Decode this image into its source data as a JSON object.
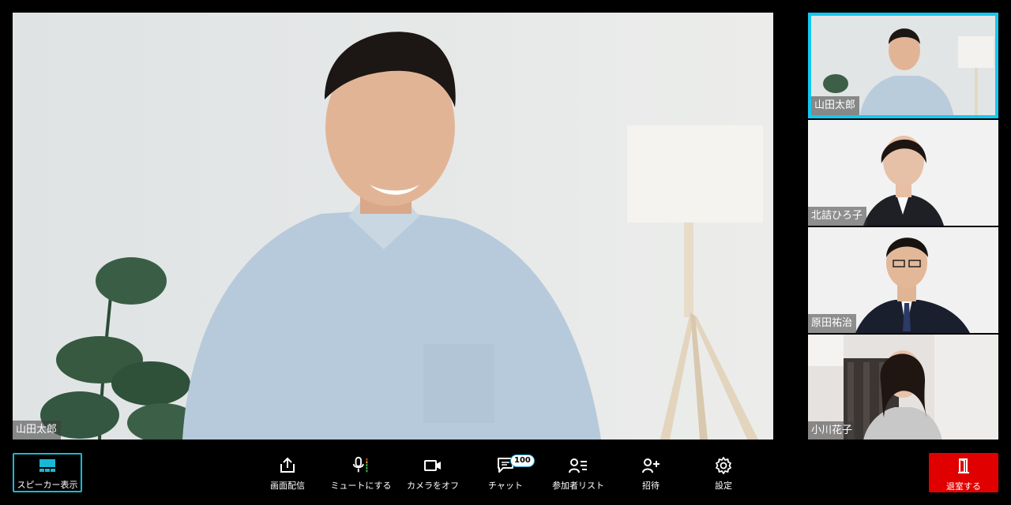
{
  "main_video": {
    "participant_name": "山田太郎"
  },
  "thumbnails": [
    {
      "name": "山田太郎",
      "active": true
    },
    {
      "name": "北詰ひろ子",
      "active": false
    },
    {
      "name": "原田祐治",
      "active": false
    },
    {
      "name": "小川花子",
      "active": false
    }
  ],
  "toolbar": {
    "speaker_view_label": "スピーカー表示",
    "share_screen_label": "画面配信",
    "mute_label": "ミュートにする",
    "camera_off_label": "カメラをオフ",
    "chat_label": "チャット",
    "chat_badge": "100",
    "participants_label": "参加者リスト",
    "invite_label": "招待",
    "settings_label": "設定",
    "leave_label": "退室する"
  },
  "colors": {
    "accent": "#14c8f0",
    "leave": "#e00000",
    "background": "#000000"
  }
}
